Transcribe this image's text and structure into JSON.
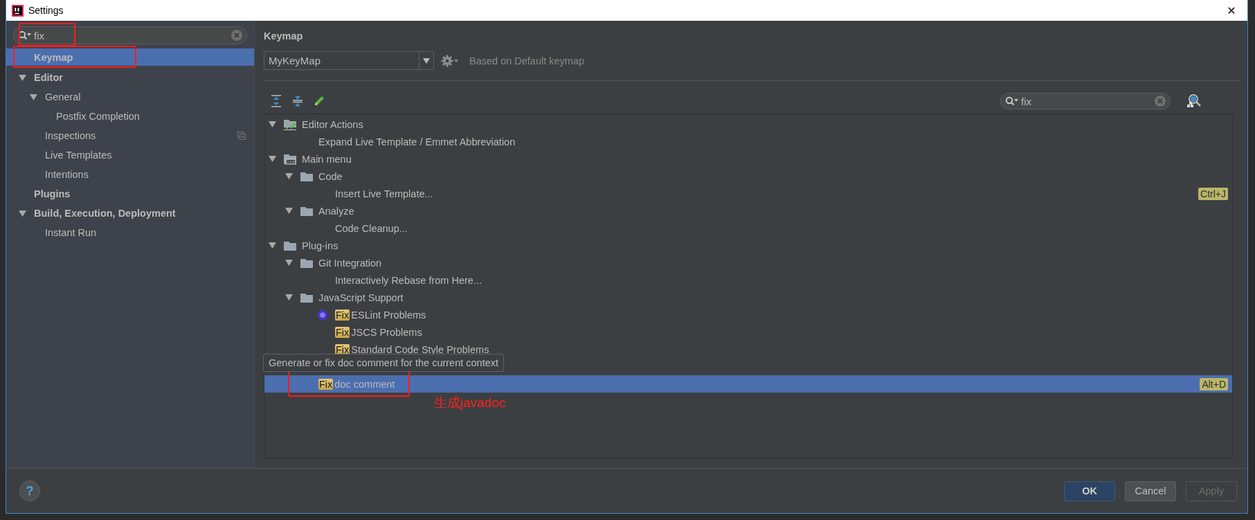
{
  "window": {
    "title": "Settings",
    "close": "✕"
  },
  "sidebar": {
    "search": {
      "value": "fix",
      "annotated": true
    },
    "items": [
      {
        "label": "Keymap",
        "bold": true,
        "selected": true,
        "annotated": true
      },
      {
        "label": "Editor",
        "bold": true,
        "selected": false,
        "expanded": true,
        "children": [
          {
            "label": "General",
            "bold": false,
            "selected": false,
            "expanded": true,
            "children": [
              {
                "label": "Postfix Completion",
                "bold": false,
                "selected": false
              }
            ]
          },
          {
            "label": "Inspections",
            "bold": false,
            "selected": false,
            "project_level": true
          },
          {
            "label": "Live Templates",
            "bold": false,
            "selected": false
          },
          {
            "label": "Intentions",
            "bold": false,
            "selected": false
          }
        ]
      },
      {
        "label": "Plugins",
        "bold": true,
        "selected": false
      },
      {
        "label": "Build, Execution, Deployment",
        "bold": true,
        "selected": false,
        "expanded": true,
        "children": [
          {
            "label": "Instant Run",
            "bold": false,
            "selected": false
          }
        ]
      }
    ]
  },
  "panel": {
    "title": "Keymap",
    "keymap_select": "MyKeyMap",
    "based_on": "Based on Default keymap",
    "tree_search": {
      "value": "fix"
    },
    "tree": [
      {
        "parts": [
          {
            "text": "Editor Actions",
            "match": false
          }
        ],
        "kind": "editor-actions",
        "expanded": true,
        "selected": false,
        "children": [
          {
            "parts": [
              {
                "text": "Expand Live Template / Emmet Abbreviation",
                "match": false
              }
            ],
            "selected": false
          }
        ]
      },
      {
        "parts": [
          {
            "text": "Main menu",
            "match": false
          }
        ],
        "kind": "main-menu",
        "expanded": true,
        "selected": false,
        "children": [
          {
            "parts": [
              {
                "text": "Code",
                "match": false
              }
            ],
            "kind": "folder",
            "expanded": true,
            "selected": false,
            "children": [
              {
                "parts": [
                  {
                    "text": "Insert Live Template...",
                    "match": false
                  }
                ],
                "shortcut": "Ctrl+J",
                "selected": false
              }
            ]
          },
          {
            "parts": [
              {
                "text": "Analyze",
                "match": false
              }
            ],
            "kind": "folder",
            "expanded": true,
            "selected": false,
            "children": [
              {
                "parts": [
                  {
                    "text": "Code Cleanup...",
                    "match": false
                  }
                ],
                "selected": false
              }
            ]
          }
        ]
      },
      {
        "parts": [
          {
            "text": "Plug-ins",
            "match": false
          }
        ],
        "kind": "folder",
        "expanded": true,
        "selected": false,
        "children": [
          {
            "parts": [
              {
                "text": "Git Integration",
                "match": false
              }
            ],
            "kind": "folder",
            "expanded": true,
            "selected": false,
            "children": [
              {
                "parts": [
                  {
                    "text": "Interactively Rebase from Here...",
                    "match": false
                  }
                ],
                "selected": false
              }
            ]
          },
          {
            "parts": [
              {
                "text": "JavaScript Support",
                "match": false
              }
            ],
            "kind": "folder",
            "expanded": true,
            "selected": false,
            "children": [
              {
                "parts": [
                  {
                    "text": "Fix",
                    "match": true
                  },
                  {
                    "text": "ESLint Problems",
                    "match": false
                  }
                ],
                "kind": "eslint",
                "selected": false
              },
              {
                "parts": [
                  {
                    "text": "Fix",
                    "match": true
                  },
                  {
                    "text": "JSCS Problems",
                    "match": false
                  }
                ],
                "selected": false
              },
              {
                "parts": [
                  {
                    "text": "Fix",
                    "match": true
                  },
                  {
                    "text": "Standard Code Style Problems",
                    "match": false
                  }
                ],
                "selected": false
              }
            ]
          },
          {
            "parts": [
              {
                "text": "Fix",
                "match": true
              },
              {
                "text": "doc comment",
                "match": false
              }
            ],
            "selected": true,
            "shortcut": "Alt+D",
            "annotated": true,
            "note": "生成javadoc",
            "tooltip": "Generate or fix doc comment for the current context"
          }
        ]
      }
    ]
  },
  "help": "?",
  "buttons": [
    {
      "label": "OK",
      "primary": true,
      "disabled": false
    },
    {
      "label": "Cancel",
      "primary": false,
      "disabled": false
    },
    {
      "label": "Apply",
      "primary": false,
      "disabled": true
    }
  ]
}
